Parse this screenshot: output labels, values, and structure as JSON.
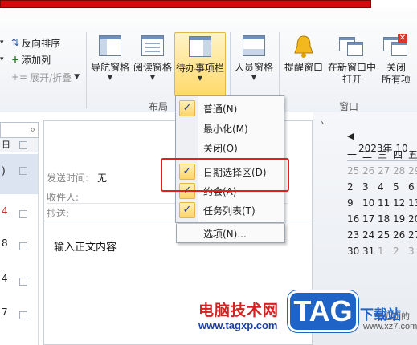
{
  "ribbon": {
    "arrange": {
      "reverse_sort": "反向排序",
      "add_column": "添加列",
      "expand_collapse": "展开/折叠"
    },
    "layout": {
      "group_label": "布局",
      "nav_pane": "导航窗格",
      "reading_pane": "阅读窗格",
      "todo_bar": "待办事项栏"
    },
    "people": {
      "people_pane": "人员窗格"
    },
    "window": {
      "group_label": "窗口",
      "reminders": "提醒窗口",
      "open_new_line1": "在新窗口中",
      "open_new_line2": "打开",
      "close_all_line1": "关闭",
      "close_all_line2": "所有项"
    }
  },
  "todo_menu": {
    "items": [
      {
        "label": "普通(N)",
        "checked": true
      },
      {
        "label": "最小化(M)",
        "checked": false
      },
      {
        "label": "关闭(O)",
        "checked": false
      },
      {
        "label": "日期选择区(D)",
        "checked": true
      },
      {
        "label": "约会(A)",
        "checked": true
      },
      {
        "label": "任务列表(T)",
        "checked": true
      },
      {
        "label": "选项(N)...",
        "checked": false
      }
    ]
  },
  "left_list": {
    "header": "日",
    "row_marks": [
      ")",
      "4",
      "8",
      "4",
      "7"
    ]
  },
  "compose": {
    "send_time_label": "发送时间:",
    "send_time_value": "无",
    "to_label": "收件人:",
    "cc_label": "抄送:",
    "body": "输入正文内容"
  },
  "calendar": {
    "month_title": "2023年 10",
    "weekday_headers": [
      "一",
      "二",
      "三",
      "四",
      "五"
    ],
    "rows": [
      [
        "25",
        "26",
        "27",
        "28",
        "29"
      ],
      [
        "2",
        "3",
        "4",
        "5",
        "6"
      ],
      [
        "9",
        "10",
        "11",
        "12",
        "13"
      ],
      [
        "16",
        "17",
        "18",
        "19",
        "20"
      ],
      [
        "23",
        "24",
        "25",
        "26",
        "27"
      ],
      [
        "30",
        "31",
        "1",
        "2",
        "3"
      ]
    ],
    "no_appointments": "无近期的"
  },
  "watermark": {
    "site_name": "电脑技术网",
    "site_url": "www.tagxp.com",
    "badge": "TAG",
    "download_label": "下载站",
    "download_url": "www.xz7.com"
  }
}
